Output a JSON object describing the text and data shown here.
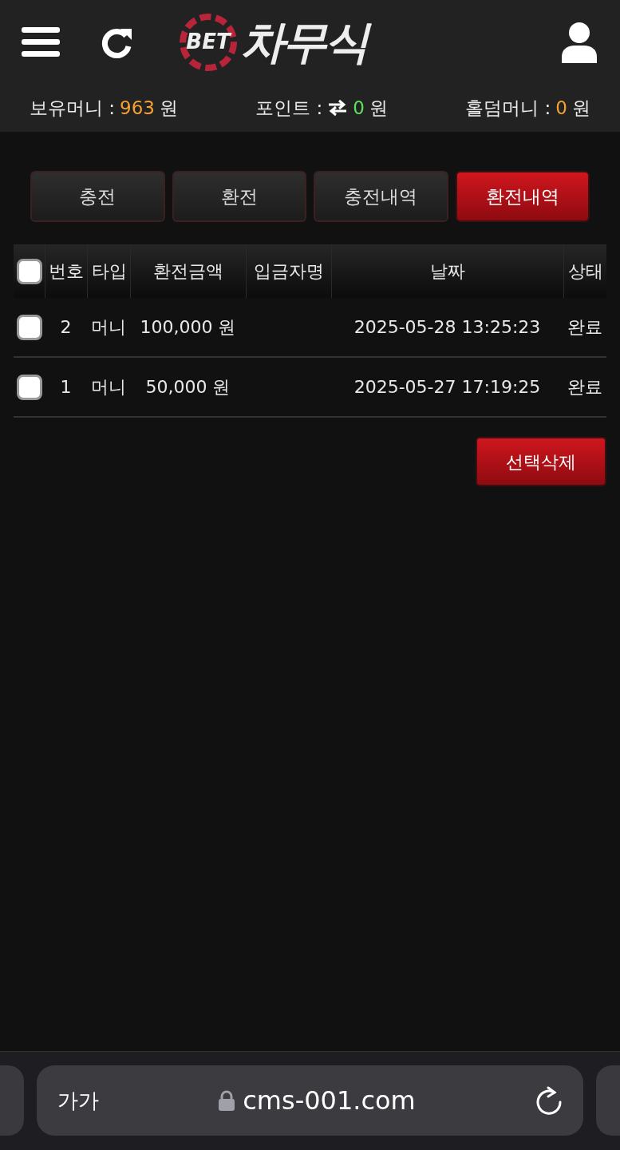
{
  "header": {
    "logo": {
      "badge": "BET",
      "name": "차무식"
    }
  },
  "balances": [
    {
      "label": "보유머니 :",
      "value": "963",
      "unit": "원",
      "color": "#f5a033",
      "exchange_icon": false
    },
    {
      "label": "포인트 :",
      "value": "0",
      "unit": "원",
      "color": "#5ee05e",
      "exchange_icon": true
    },
    {
      "label": "홀덤머니 :",
      "value": "0",
      "unit": "원",
      "color": "#f5a033",
      "exchange_icon": false
    }
  ],
  "tabs": [
    {
      "label": "충전",
      "selected": false
    },
    {
      "label": "환전",
      "selected": false
    },
    {
      "label": "충전내역",
      "selected": false
    },
    {
      "label": "환전내역",
      "selected": true
    }
  ],
  "table": {
    "select_all": {
      "checked": false
    },
    "columns": [
      "번호",
      "타입",
      "환전금액",
      "입금자명",
      "날짜",
      "상태"
    ],
    "rows": [
      {
        "checked": false,
        "cells": [
          "2",
          "머니",
          "100,000 원",
          "",
          "2025-05-28 13:25:23",
          "완료"
        ]
      },
      {
        "checked": false,
        "cells": [
          "1",
          "머니",
          "50,000 원",
          "",
          "2025-05-27 17:19:25",
          "완료"
        ]
      }
    ]
  },
  "delete_button": "선택삭제",
  "browser": {
    "text_size": "가가",
    "url": "cms-001.com"
  }
}
